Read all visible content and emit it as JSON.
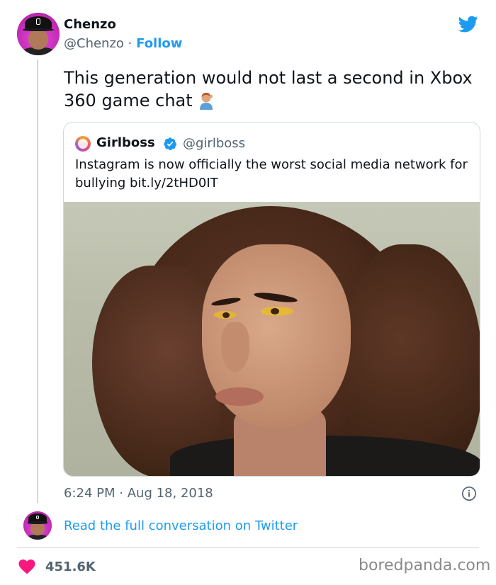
{
  "author": {
    "name": "Chenzo",
    "handle": "@Chenzo",
    "separator": "·",
    "follow_label": "Follow"
  },
  "tweet": {
    "text": "This generation would not last a second in Xbox 360 game chat",
    "emoji": "person-facepalming-emoji"
  },
  "quote": {
    "name": "Girlboss",
    "handle": "@girlboss",
    "text": "Instagram is now officially the worst social media network for bullying bit.ly/2tHD0IT",
    "verified": true
  },
  "meta": {
    "time": "6:24 PM",
    "separator": "·",
    "date": "Aug 18, 2018"
  },
  "read_link": "Read the full conversation on Twitter",
  "likes": {
    "count": "451.6K"
  },
  "watermark": "boredpanda.com",
  "colors": {
    "accent": "#1d9bf0",
    "text": "#0f1419",
    "muted": "#536471",
    "heart": "#f91880",
    "border": "#cfd9de"
  },
  "icons": [
    "twitter-bird-icon",
    "verified-badge-icon",
    "info-icon",
    "heart-icon"
  ]
}
